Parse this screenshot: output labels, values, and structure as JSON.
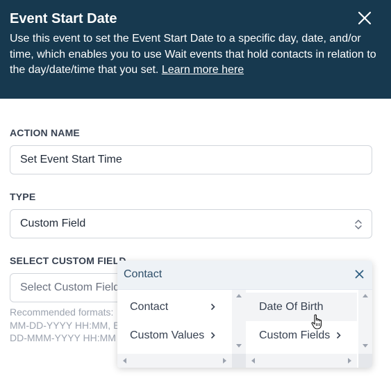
{
  "header": {
    "title": "Event Start Date",
    "description": "Use this event to set the Event Start Date to a specific day, date, and/or time, which enables you to use Wait events that hold contacts in relation to the day/date/time that you set.",
    "link_text": "Learn more here",
    "close_icon": "close-icon"
  },
  "form": {
    "action_name": {
      "label": "ACTION NAME",
      "value": "Set Event Start Time"
    },
    "type": {
      "label": "TYPE",
      "value": "Custom Field",
      "icon": "chevron-up-down-icon"
    },
    "custom_field": {
      "label": "SELECT CUSTOM FIELD",
      "placeholder": "Select Custom Field",
      "hint": "Recommended formats: \nMM-DD-YYYY HH:MM, E\nDD-MMM-YYYY HH:MM"
    }
  },
  "dropdown": {
    "title": "Contact",
    "close_icon": "close-icon",
    "column1": [
      {
        "label": "Contact",
        "icon": "chevron-right-icon"
      },
      {
        "label": "Custom Values",
        "icon": "chevron-right-icon"
      }
    ],
    "column2": [
      {
        "label": "Date Of Birth"
      },
      {
        "label": "Custom Fields",
        "icon": "chevron-right-icon"
      }
    ]
  },
  "colors": {
    "header_bg": "#17394f",
    "dropdown_title": "#2f4f6a",
    "hover_bg": "#f3f4f6"
  },
  "cursor_icon": "hand-pointer-icon"
}
